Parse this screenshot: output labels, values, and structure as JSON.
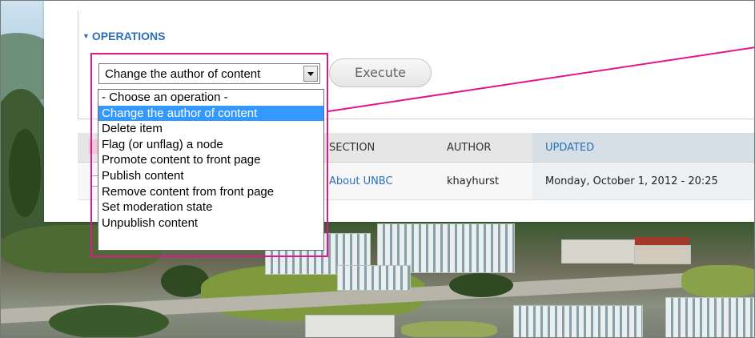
{
  "operations": {
    "legend": "OPERATIONS",
    "selected": "Change the author of content",
    "execute_label": "Execute",
    "options": [
      "- Choose an operation -",
      "Change the author of content",
      "Delete item",
      "Flag (or unflag) a node",
      "Promote content to front page",
      "Publish content",
      "Remove content from front page",
      "Set moderation state",
      "Unpublish content"
    ],
    "selected_index": 1
  },
  "table": {
    "headers": {
      "section": "SECTION",
      "author": "AUTHOR",
      "updated": "UPDATED"
    },
    "rows": [
      {
        "section": "About UNBC",
        "author": "khayhurst",
        "updated": "Monday, October 1, 2012 - 20:25"
      }
    ]
  },
  "colors": {
    "highlight": "#e0168c",
    "link": "#2a70b8",
    "selected_option": "#3399ff"
  }
}
